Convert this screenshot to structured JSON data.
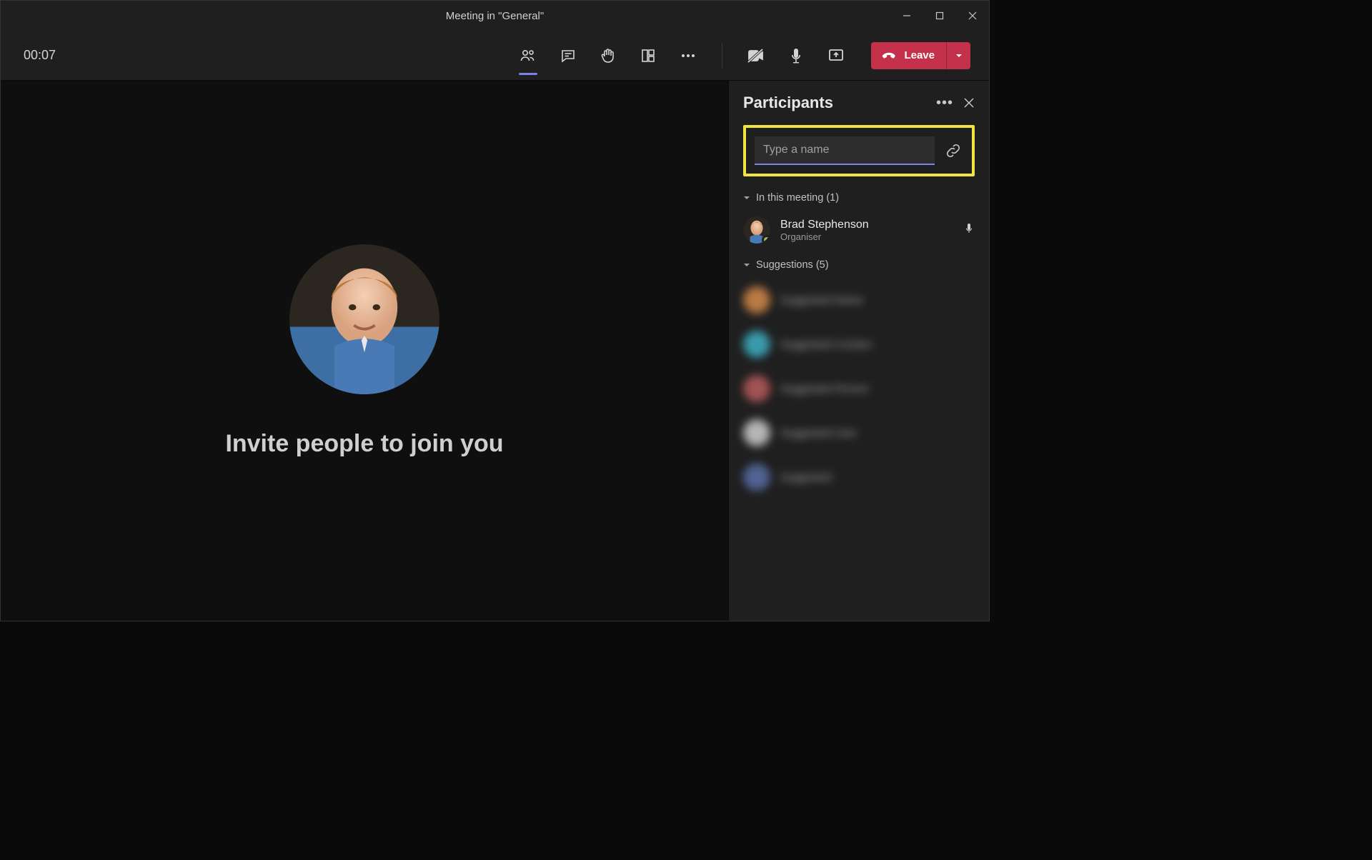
{
  "window": {
    "title": "Meeting in \"General\""
  },
  "toolbar": {
    "timer": "00:07",
    "leave_label": "Leave"
  },
  "stage": {
    "invite_text": "Invite people to join you"
  },
  "panel": {
    "title": "Participants",
    "search_placeholder": "Type a name",
    "in_meeting_label": "In this meeting (1)",
    "suggestions_label": "Suggestions (5)",
    "participant": {
      "name": "Brad Stephenson",
      "role": "Organiser"
    },
    "suggestions": [
      {
        "color": "#d68a4a",
        "text": "Suggested Name"
      },
      {
        "color": "#3fb0c4",
        "text": "Suggested Contact"
      },
      {
        "color": "#b85c5c",
        "text": "Suggested Person"
      },
      {
        "color": "#cfcfcf",
        "text": "Suggested User"
      },
      {
        "color": "#5a6fa8",
        "text": "Suggested"
      }
    ]
  }
}
